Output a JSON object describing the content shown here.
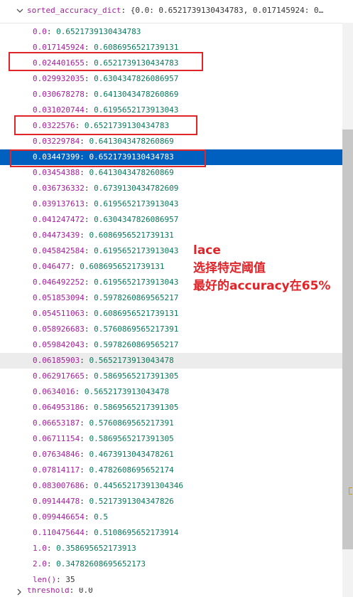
{
  "header": {
    "var_name": "sorted_accuracy_dict",
    "preview": ": {0.0: 0.6521739130434783, 0.017145924: 0…"
  },
  "rows": [
    {
      "key": "0.0",
      "value": "0.6521739130434783"
    },
    {
      "key": "0.017145924",
      "value": "0.6086956521739131"
    },
    {
      "key": "0.024401655",
      "value": "0.6521739130434783"
    },
    {
      "key": "0.029932035",
      "value": "0.6304347826086957"
    },
    {
      "key": "0.030678278",
      "value": "0.6413043478260869"
    },
    {
      "key": "0.031020744",
      "value": "0.6195652173913043"
    },
    {
      "key": "0.0322576",
      "value": "0.6521739130434783"
    },
    {
      "key": "0.03229784",
      "value": "0.6413043478260869"
    },
    {
      "key": "0.03447399",
      "value": "0.6521739130434783"
    },
    {
      "key": "0.03454388",
      "value": "0.6413043478260869"
    },
    {
      "key": "0.036736332",
      "value": "0.6739130434782609"
    },
    {
      "key": "0.039137613",
      "value": "0.6195652173913043"
    },
    {
      "key": "0.041247472",
      "value": "0.6304347826086957"
    },
    {
      "key": "0.04473439",
      "value": "0.6086956521739131"
    },
    {
      "key": "0.045842584",
      "value": "0.6195652173913043"
    },
    {
      "key": "0.046477",
      "value": "0.6086956521739131"
    },
    {
      "key": "0.046492252",
      "value": "0.6195652173913043"
    },
    {
      "key": "0.051853094",
      "value": "0.5978260869565217"
    },
    {
      "key": "0.054511063",
      "value": "0.6086956521739131"
    },
    {
      "key": "0.058926683",
      "value": "0.5760869565217391"
    },
    {
      "key": "0.059842043",
      "value": "0.5978260869565217"
    },
    {
      "key": "0.06185903",
      "value": "0.5652173913043478"
    },
    {
      "key": "0.062917665",
      "value": "0.5869565217391305"
    },
    {
      "key": "0.0634016",
      "value": "0.5652173913043478"
    },
    {
      "key": "0.064953186",
      "value": "0.5869565217391305"
    },
    {
      "key": "0.06653187",
      "value": "0.5760869565217391"
    },
    {
      "key": "0.06711154",
      "value": "0.5869565217391305"
    },
    {
      "key": "0.07634846",
      "value": "0.4673913043478261"
    },
    {
      "key": "0.07814117",
      "value": "0.4782608695652174"
    },
    {
      "key": "0.083007686",
      "value": "0.44565217391304346"
    },
    {
      "key": "0.09144478",
      "value": "0.5217391304347826"
    },
    {
      "key": "0.099446654",
      "value": "0.5"
    },
    {
      "key": "0.110475644",
      "value": "0.5108695652173914"
    },
    {
      "key": "1.0",
      "value": "0.358695652173913"
    },
    {
      "key": "2.0",
      "value": "0.34782608695652173"
    }
  ],
  "len_row": {
    "key": "len()",
    "value": "35"
  },
  "bottom": {
    "var_name": "threshold",
    "value": "0.0"
  },
  "annotation": {
    "line1": "lace",
    "line2": "选择特定阈值",
    "line3": "最好的accuracy在65%"
  },
  "colors": {
    "key": "#a31f9b",
    "value": "#0a7a5a",
    "selection": "#0060c0",
    "annotation": "#e0252a"
  }
}
